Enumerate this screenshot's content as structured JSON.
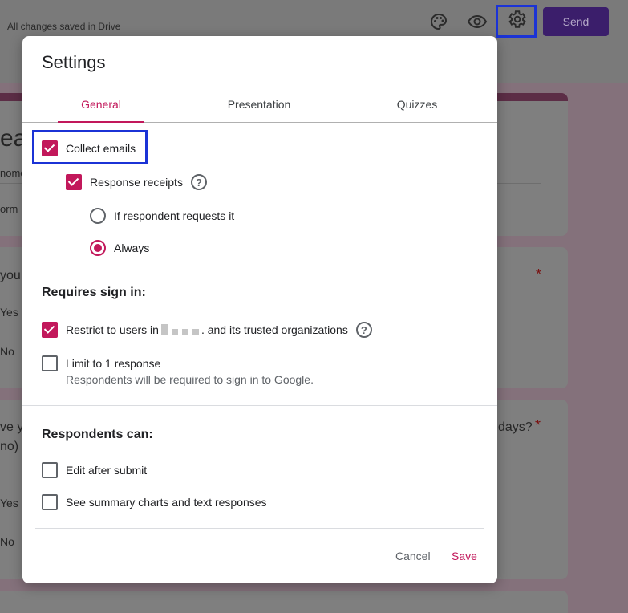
{
  "header": {
    "save_status": "All changes saved in Drive",
    "send_label": "Send",
    "icons": [
      "palette-icon",
      "eye-icon",
      "gear-icon"
    ]
  },
  "background": {
    "title_fragment": "eal",
    "line1": "nome",
    "line2": "orm",
    "q1": "you",
    "q1_opt1": "Yes",
    "q1_opt2": "No",
    "q2_line1": "ve y",
    "q2_line2": "no)",
    "q2_tail": "days?",
    "q2_opt1": "Yes",
    "q2_opt2": "No",
    "required_mark": "*"
  },
  "dialog": {
    "title": "Settings",
    "tabs": [
      {
        "label": "General",
        "active": true
      },
      {
        "label": "Presentation",
        "active": false
      },
      {
        "label": "Quizzes",
        "active": false
      }
    ],
    "general": {
      "collect_emails": {
        "label": "Collect emails",
        "checked": true
      },
      "response_receipts": {
        "label": "Response receipts",
        "checked": true,
        "help": "?"
      },
      "receipt_options": [
        {
          "label": "If respondent requests it",
          "selected": false
        },
        {
          "label": "Always",
          "selected": true
        }
      ],
      "requires_sign_in": {
        "heading": "Requires sign in:",
        "restrict": {
          "label_before": "Restrict to users in",
          "label_after": ". and its trusted organizations",
          "checked": true,
          "help": "?"
        },
        "limit": {
          "label": "Limit to 1 response",
          "note": "Respondents will be required to sign in to Google.",
          "checked": false
        }
      },
      "respondents_can": {
        "heading": "Respondents can:",
        "options": [
          {
            "label": "Edit after submit",
            "checked": false
          },
          {
            "label": "See summary charts and text responses",
            "checked": false
          }
        ]
      }
    },
    "actions": {
      "cancel": "Cancel",
      "save": "Save"
    }
  },
  "colors": {
    "accent": "#c2185b",
    "highlight": "#1b33d6",
    "send": "#3b1e6b"
  }
}
